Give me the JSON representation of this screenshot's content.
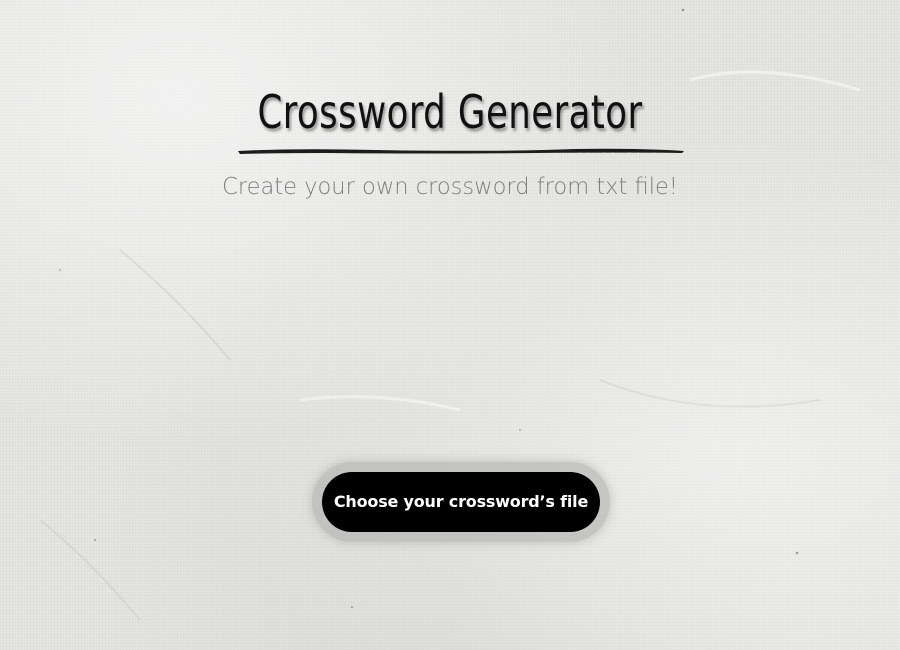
{
  "header": {
    "title": "Crossword Generator",
    "subtitle": "Create your own crossword from txt file!"
  },
  "upload": {
    "button_label": "Choose your crossword’s file"
  },
  "colors": {
    "background": "#e4e4e2",
    "title": "#111111",
    "subtitle": "#7d7d7d",
    "button_bg": "#000000",
    "button_text": "#ffffff"
  }
}
